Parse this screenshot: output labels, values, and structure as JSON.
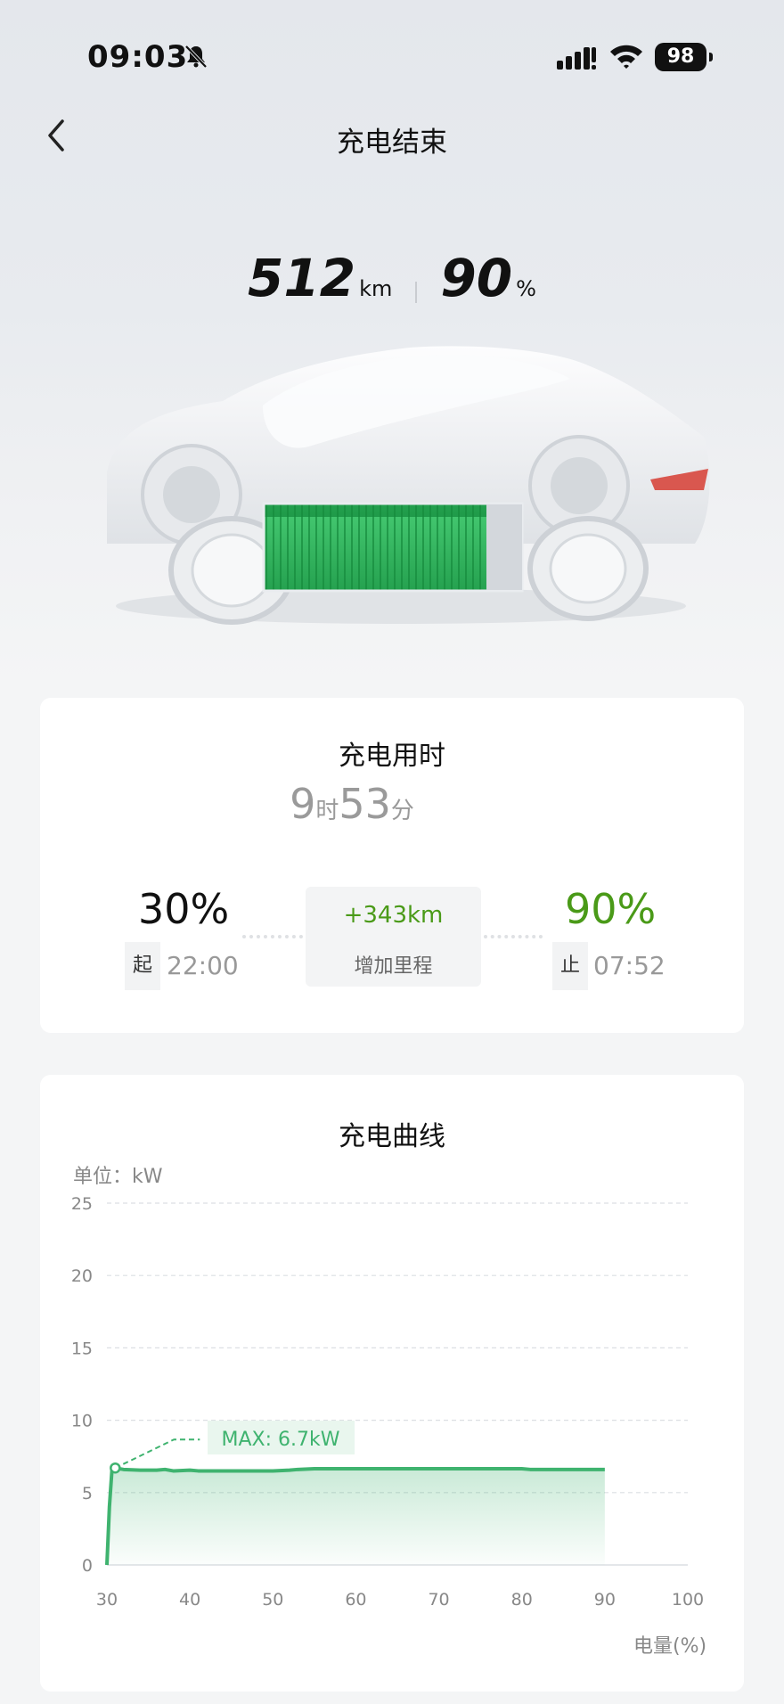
{
  "status_bar": {
    "time": "09:03",
    "battery": "98"
  },
  "header": {
    "title": "充电结束"
  },
  "summary": {
    "range_value": "512",
    "range_unit": "km",
    "soc_value": "90",
    "soc_unit": "%"
  },
  "duration_card": {
    "title": "充电用时",
    "hours": "9",
    "hours_unit": "时",
    "minutes": "53",
    "minutes_unit": "分",
    "start_soc": "30%",
    "start_tag": "起",
    "start_time": "22:00",
    "added_range": "+343km",
    "added_range_label": "增加里程",
    "end_soc": "90%",
    "end_tag": "止",
    "end_time": "07:52"
  },
  "curve_card": {
    "title": "充电曲线",
    "unit_label": "单位：kW",
    "x_axis_label": "电量(%)",
    "max_label": "MAX: 6.7kW"
  },
  "colors": {
    "accent_green": "#4a9a18",
    "curve_green": "#3fb36f",
    "battery_green": "#2fb35c"
  },
  "chart_data": {
    "type": "area",
    "title": "充电曲线",
    "ylabel": "单位：kW",
    "xlabel": "电量(%)",
    "xlim": [
      30,
      100
    ],
    "ylim": [
      0,
      25
    ],
    "x_ticks": [
      30,
      40,
      50,
      60,
      70,
      80,
      90,
      100
    ],
    "y_ticks": [
      0,
      5,
      10,
      15,
      20,
      25
    ],
    "grid": true,
    "annotation": {
      "text": "MAX: 6.7kW",
      "x": 31,
      "y": 6.7
    },
    "series": [
      {
        "x": [
          30,
          30.3,
          30.6,
          31,
          32,
          34,
          36,
          37,
          38,
          40,
          41,
          45,
          50,
          52,
          53,
          55,
          60,
          70,
          80,
          81,
          85,
          90
        ],
        "values": [
          0,
          4,
          6.5,
          6.7,
          6.6,
          6.55,
          6.55,
          6.6,
          6.5,
          6.55,
          6.5,
          6.5,
          6.5,
          6.55,
          6.6,
          6.65,
          6.65,
          6.65,
          6.65,
          6.6,
          6.6,
          6.6
        ]
      }
    ]
  }
}
